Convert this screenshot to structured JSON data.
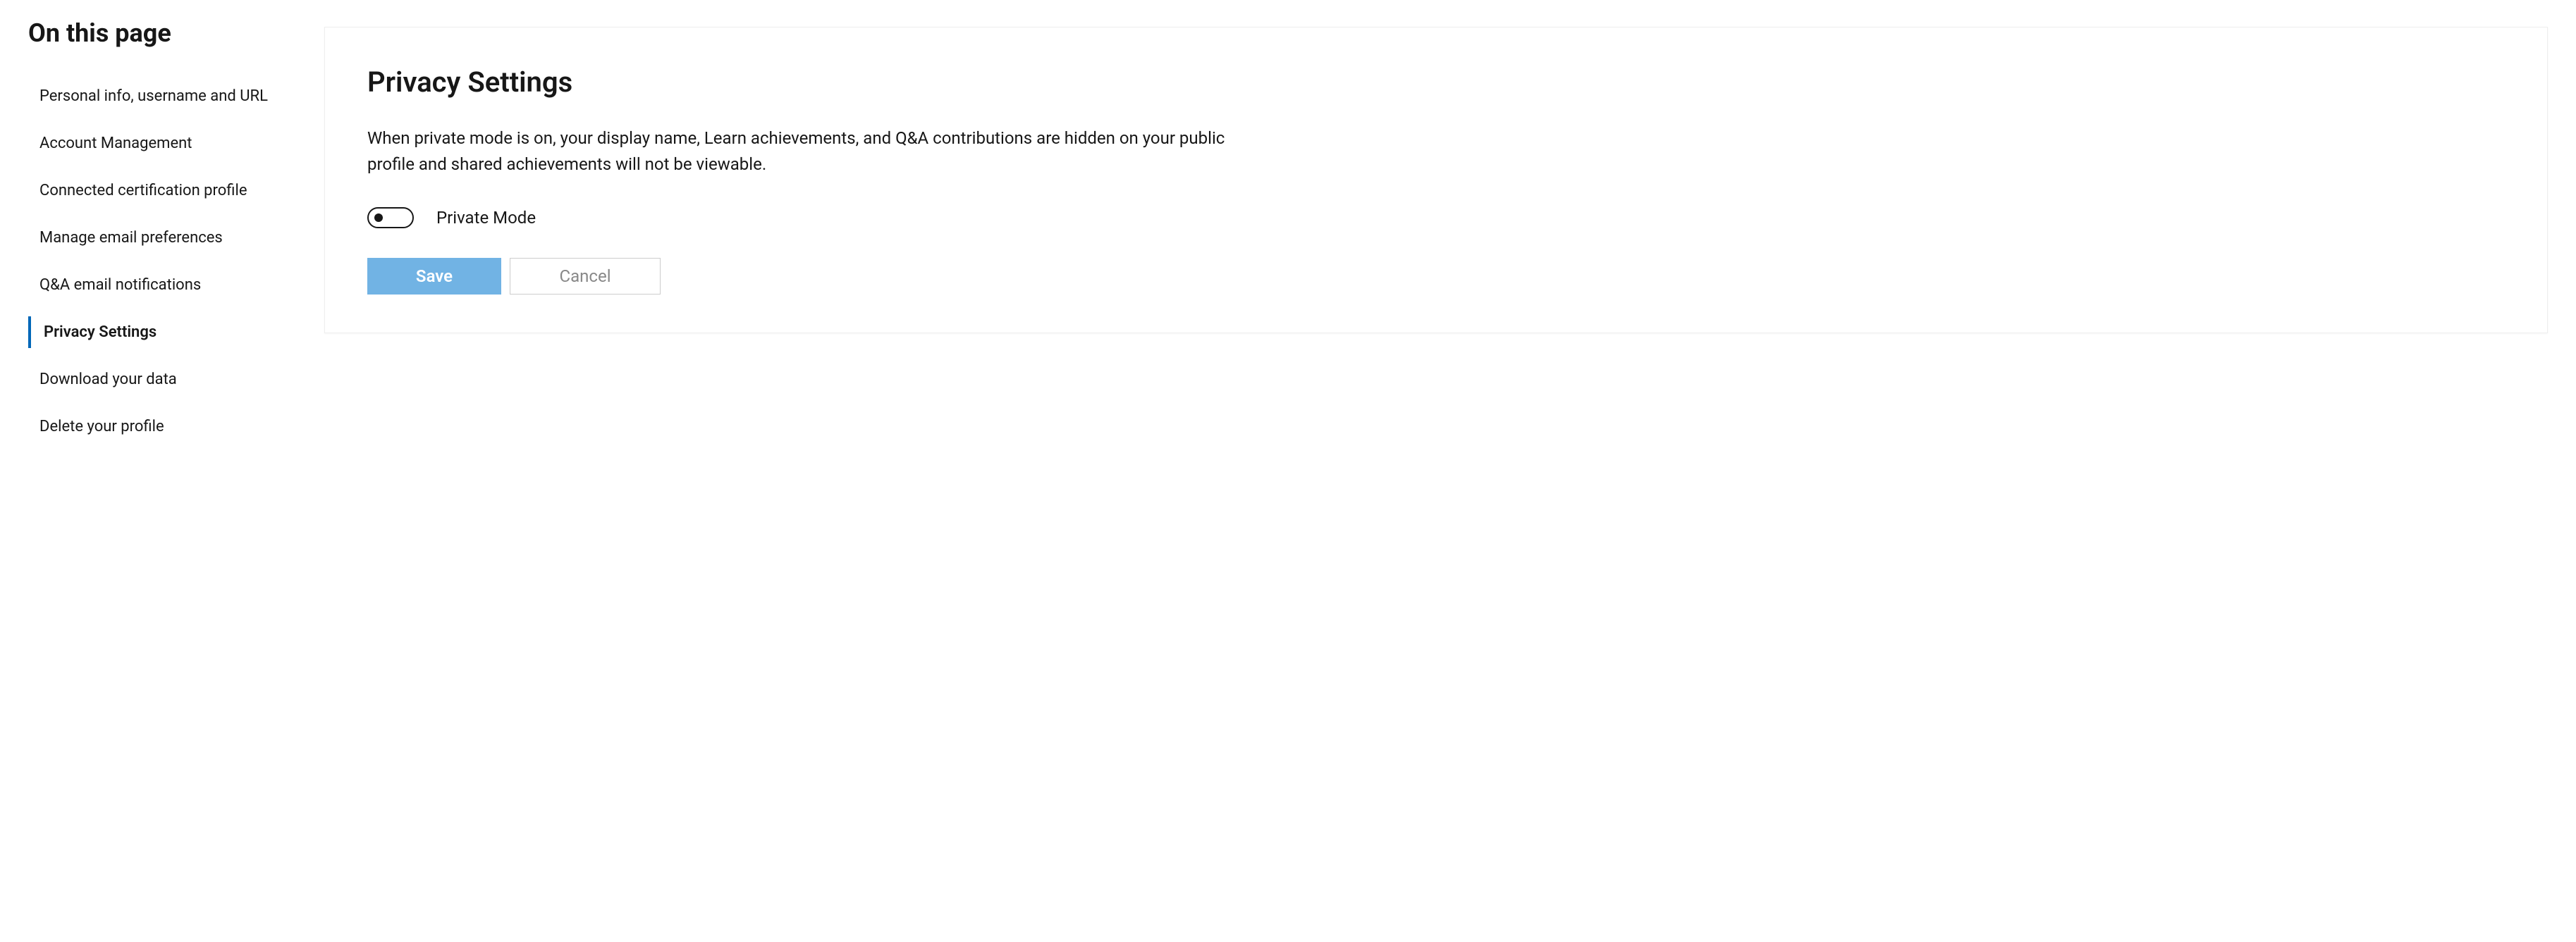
{
  "sidebar": {
    "title": "On this page",
    "items": [
      {
        "label": "Personal info, username and URL",
        "active": false
      },
      {
        "label": "Account Management",
        "active": false
      },
      {
        "label": "Connected certification profile",
        "active": false
      },
      {
        "label": "Manage email preferences",
        "active": false
      },
      {
        "label": "Q&A email notifications",
        "active": false
      },
      {
        "label": "Privacy Settings",
        "active": true
      },
      {
        "label": "Download your data",
        "active": false
      },
      {
        "label": "Delete your profile",
        "active": false
      }
    ]
  },
  "panel": {
    "title": "Privacy Settings",
    "description": "When private mode is on, your display name, Learn achievements, and Q&A contributions are hidden on your public profile and shared achievements will not be viewable.",
    "toggle": {
      "label": "Private Mode",
      "on": false
    },
    "buttons": {
      "save": "Save",
      "cancel": "Cancel"
    }
  }
}
